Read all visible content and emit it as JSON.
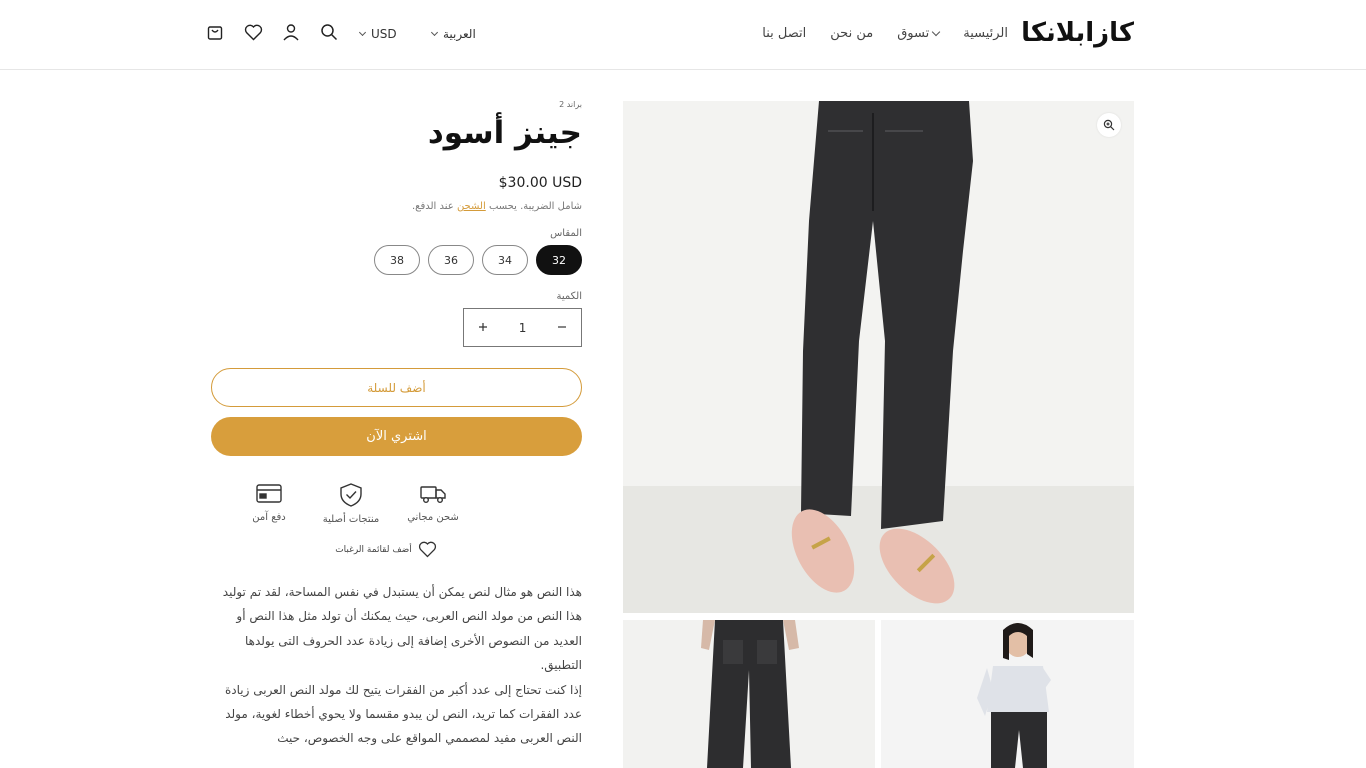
{
  "header": {
    "logo": "كازابلانكا",
    "nav": [
      {
        "label": "الرئيسية",
        "has_dropdown": false
      },
      {
        "label": "تسوق",
        "has_dropdown": true
      },
      {
        "label": "من نحن",
        "has_dropdown": false
      },
      {
        "label": "اتصل بنا",
        "has_dropdown": false
      }
    ],
    "language": "العربية",
    "currency": "USD",
    "icons": [
      "search-icon",
      "account-icon",
      "wishlist-heart-icon",
      "cart-icon"
    ]
  },
  "product": {
    "brand": "براند 2",
    "title": "جينز أسود",
    "price": "$30.00 USD",
    "tax_note_before": "شامل الضريبة. يحسب ",
    "tax_note_link": "الشحن",
    "tax_note_after": " عند الدفع.",
    "size_label": "المقاس",
    "sizes": [
      "32",
      "34",
      "36",
      "38"
    ],
    "selected_size": "32",
    "quantity_label": "الكمية",
    "quantity": "1",
    "add_to_cart": "أضف للسلة",
    "buy_now": "اشتري الآن",
    "features": [
      {
        "icon": "truck-icon",
        "label": "شحن مجاني"
      },
      {
        "icon": "shield-check-icon",
        "label": "منتجات أصلية"
      },
      {
        "icon": "credit-card-icon",
        "label": "دفع آمن"
      }
    ],
    "wishlist": "أضف لقائمة الرغبات",
    "description": [
      "هذا النص هو مثال لنص يمكن أن يستبدل في نفس المساحة، لقد تم توليد هذا النص من مولد النص العربى، حيث يمكنك أن تولد مثل هذا النص أو العديد من النصوص الأخرى إضافة إلى زيادة عدد الحروف التى يولدها التطبيق.",
      "إذا كنت تحتاج إلى عدد أكبر من الفقرات يتيح لك مولد النص العربى زيادة عدد الفقرات كما تريد، النص لن يبدو مقسما ولا يحوي أخطاء لغوية، مولد النص العربى مفيد لمصممي المواقع على وجه الخصوص، حيث"
    ]
  },
  "colors": {
    "accent": "#d89e3c",
    "selected_size_bg": "#111111"
  }
}
